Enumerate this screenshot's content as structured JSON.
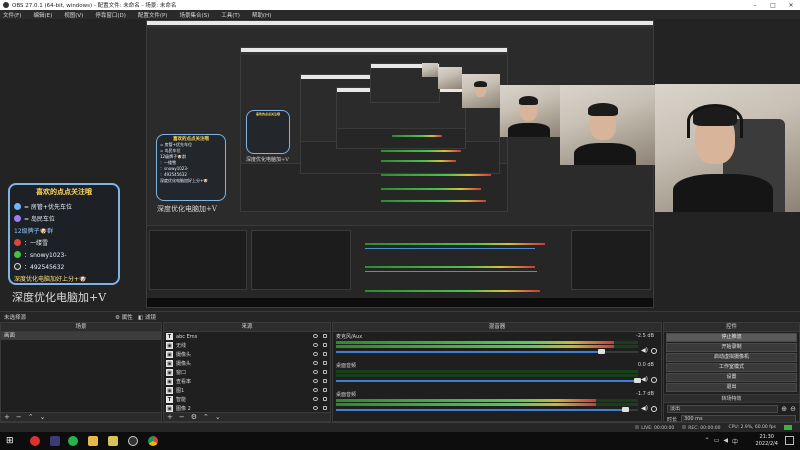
{
  "window": {
    "title": "OBS 27.0.1 (64-bit, windows) - 配置文件: 未命名 - 场景: 未命名"
  },
  "menu": [
    "文件(F)",
    "编辑(E)",
    "视图(V)",
    "停靠窗口(D)",
    "配置文件(P)",
    "场景集合(S)",
    "工具(T)",
    "帮助(H)"
  ],
  "overlay_card": {
    "title": "喜欢的点点关注哦",
    "lines": [
      {
        "icon": "diamond-icon",
        "text": "= 房管+优先车位"
      },
      {
        "icon": "ticket-icon",
        "text": "= 岛民车位"
      },
      {
        "icon": "wechat-icon",
        "text": "12级牌子🐶群",
        "prefix_style": "blue"
      },
      {
        "icon": "weibo-icon",
        "text": "：一缕雪"
      },
      {
        "icon": "wechat-icon",
        "text": "：snowy1023-"
      },
      {
        "icon": "qq-icon",
        "text": "：492545632"
      },
      {
        "icon": "star-icon",
        "text": "深度优化电脑加好上分+🐶"
      }
    ],
    "watermark": "深度优化电脑加+V"
  },
  "docks": {
    "scene_transition_title": "未选择源",
    "properties_label": "属性",
    "filters_label": "滤镜",
    "scenes": {
      "header": "场景",
      "items": [
        "画面"
      ]
    },
    "sources": {
      "header": "来源",
      "items": [
        {
          "icon": "T",
          "name": "abc Ems"
        },
        {
          "icon": "▣",
          "name": "无线"
        },
        {
          "icon": "▣",
          "name": "摄像头"
        },
        {
          "icon": "▣",
          "name": "摄像头"
        },
        {
          "icon": "▣",
          "name": "窗口"
        },
        {
          "icon": "▣",
          "name": "查看率"
        },
        {
          "icon": "▣",
          "name": "图1"
        },
        {
          "icon": "T",
          "name": "智能"
        },
        {
          "icon": "▣",
          "name": "图像 2"
        }
      ]
    },
    "mixer": {
      "header": "混音器",
      "channels": [
        {
          "name": "麦克风/Aux",
          "db": "-2.5 dB",
          "level": 0.92,
          "fader": 0.88
        },
        {
          "name": "桌面音频",
          "db": "0.0 dB",
          "level": 0.0,
          "fader": 1.0
        },
        {
          "name": "桌面音频",
          "db": "-1.7 dB",
          "level": 0.86,
          "fader": 0.96
        }
      ]
    },
    "transitions": {
      "header": "转场特效",
      "value": "淡出",
      "duration_label": "时长",
      "duration_value": "300 ms"
    },
    "controls": {
      "header": "控件",
      "buttons": [
        "停止推流",
        "开始录制",
        "启动虚拟摄像机",
        "工作室模式",
        "设置",
        "退出"
      ]
    }
  },
  "status": {
    "live": "LIVE: 00:00:00",
    "rec": "REC: 00:00:00",
    "cpu": "CPU: 2.9%, 60.00 fps"
  },
  "taskbar": {
    "time": "21:30",
    "date": "2022/2/4",
    "apps": [
      "start-icon",
      "weibo-app-icon",
      "netease-icon",
      "wechat-app-icon",
      "folder-icon",
      "obs-app-icon",
      "alien-app-icon",
      "chrome-icon"
    ]
  },
  "colors": {
    "accent_blue": "#3f7fd1",
    "meter_green": "#4fc24f",
    "card_border": "#7fb4e6",
    "card_title": "#ffd75e"
  }
}
